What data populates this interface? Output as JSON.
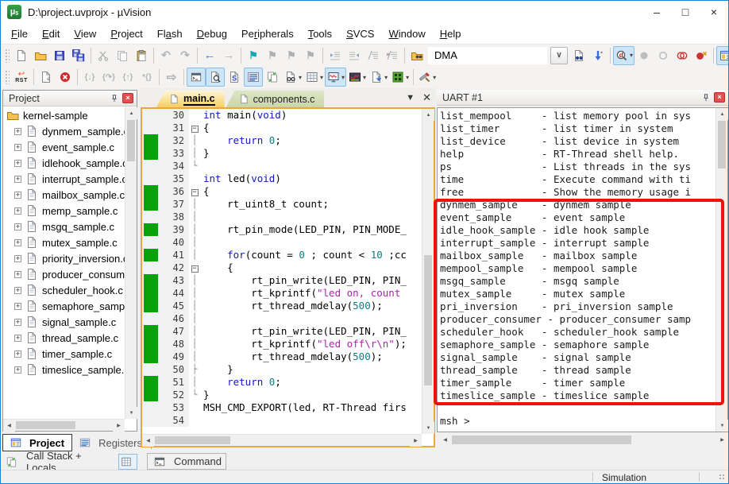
{
  "window": {
    "title": "D:\\project.uvprojx - µVision",
    "controls": {
      "minimize": "–",
      "maximize": "□",
      "close": "×"
    }
  },
  "menu": {
    "items": [
      {
        "label": "File",
        "u": 0
      },
      {
        "label": "Edit",
        "u": 0
      },
      {
        "label": "View",
        "u": 0
      },
      {
        "label": "Project",
        "u": 0
      },
      {
        "label": "Flash",
        "u": 2
      },
      {
        "label": "Debug",
        "u": 0
      },
      {
        "label": "Peripherals",
        "u": 2
      },
      {
        "label": "Tools",
        "u": 0
      },
      {
        "label": "SVCS",
        "u": 0
      },
      {
        "label": "Window",
        "u": 0
      },
      {
        "label": "Help",
        "u": 0
      }
    ]
  },
  "toolbar_main": {
    "search_value": "DMA",
    "items": [
      {
        "grip": true
      },
      {
        "n": "new-file",
        "k": "page"
      },
      {
        "n": "open-file",
        "k": "folder"
      },
      {
        "n": "save",
        "k": "floppy"
      },
      {
        "n": "save-all",
        "k": "floppy2"
      },
      {
        "sep": true
      },
      {
        "n": "cut",
        "k": "scissors"
      },
      {
        "n": "copy",
        "k": "copy"
      },
      {
        "n": "paste",
        "k": "paste"
      },
      {
        "sep": true
      },
      {
        "n": "undo",
        "k": "undo"
      },
      {
        "n": "redo",
        "k": "redo"
      },
      {
        "sep": true
      },
      {
        "n": "navigate-back",
        "k": "arrowL"
      },
      {
        "n": "navigate-forward",
        "k": "arrowR"
      },
      {
        "sep": true
      },
      {
        "n": "bookmark-toggle",
        "k": "flag"
      },
      {
        "n": "bookmark-prev",
        "k": "flagP"
      },
      {
        "n": "bookmark-next",
        "k": "flagN"
      },
      {
        "n": "bookmark-clear",
        "k": "flagX"
      },
      {
        "sep": true
      },
      {
        "n": "indent",
        "k": "indentR"
      },
      {
        "n": "unindent",
        "k": "indentL"
      },
      {
        "n": "comment",
        "k": "comment"
      },
      {
        "n": "uncomment",
        "k": "uncomment"
      },
      {
        "sep": true
      },
      {
        "n": "find-in-files",
        "k": "folderfind"
      },
      {
        "combo": true
      },
      {
        "n": "search-dropdown",
        "k": "vee"
      },
      {
        "n": "find-in-files-doc",
        "k": "docfind"
      },
      {
        "n": "incremental-find",
        "k": "incsearch"
      },
      {
        "sep": true
      },
      {
        "n": "highlight-word",
        "k": "magd",
        "hl": true,
        "dd": true
      },
      {
        "n": "breakpoint-insert",
        "k": "dotGray"
      },
      {
        "n": "breakpoint-enable",
        "k": "circGray"
      },
      {
        "n": "breakpoint-disable-all",
        "k": "circRed"
      },
      {
        "n": "breakpoint-kill-all",
        "k": "circRedX"
      },
      {
        "sep": true
      },
      {
        "n": "configuration-window",
        "k": "winbook",
        "hl": true
      }
    ]
  },
  "toolbar_debug": {
    "items": [
      {
        "grip": true
      },
      {
        "n": "reset",
        "k": "rst"
      },
      {
        "sep": true
      },
      {
        "n": "show-next-statement",
        "k": "steplist"
      },
      {
        "n": "stop",
        "k": "stopx"
      },
      {
        "sep": true
      },
      {
        "n": "step-into",
        "k": "stepin"
      },
      {
        "n": "step-over",
        "k": "stepover"
      },
      {
        "n": "step-out",
        "k": "stepout"
      },
      {
        "n": "run-to-cursor",
        "k": "runto"
      },
      {
        "sep": true
      },
      {
        "n": "run",
        "k": "runarrow"
      },
      {
        "sep": true
      },
      {
        "n": "command-window",
        "k": "cmdwin",
        "hl": true
      },
      {
        "n": "disassembly-window",
        "k": "disasm",
        "hl": true
      },
      {
        "n": "symbol-window",
        "k": "symbol"
      },
      {
        "n": "registers-window",
        "k": "registers",
        "hl": true
      },
      {
        "n": "call-stack-window",
        "k": "callstack"
      },
      {
        "n": "watch-window",
        "k": "watch",
        "dd": true
      },
      {
        "n": "memory-window",
        "k": "memory",
        "dd": true
      },
      {
        "n": "serial-window",
        "k": "serial",
        "hl": true,
        "dd": true
      },
      {
        "n": "analysis-window",
        "k": "analysis",
        "dd": true
      },
      {
        "n": "trace-window",
        "k": "trace",
        "dd": true
      },
      {
        "n": "system-viewer",
        "k": "sysview",
        "dd": true
      },
      {
        "sep": true
      },
      {
        "n": "toolbox",
        "k": "toolbox",
        "dd": true
      }
    ]
  },
  "project_panel": {
    "title": "Project",
    "root": "kernel-sample",
    "files": [
      "dynmem_sample.c",
      "event_sample.c",
      "idlehook_sample.c",
      "interrupt_sample.c",
      "mailbox_sample.c",
      "memp_sample.c",
      "msgq_sample.c",
      "mutex_sample.c",
      "priority_inversion.c",
      "producer_consumer",
      "scheduler_hook.c",
      "semaphore_sample.",
      "signal_sample.c",
      "thread_sample.c",
      "timer_sample.c",
      "timeslice_sample.c"
    ]
  },
  "editor": {
    "tabs": [
      {
        "label": "main.c",
        "active": true
      },
      {
        "label": "components.c",
        "active": false
      }
    ],
    "code": {
      "lines": [
        {
          "n": 30,
          "f": "",
          "g": false,
          "s": [
            [
              "k",
              "int"
            ],
            [
              "p",
              " main("
            ],
            [
              "k",
              "void"
            ],
            [
              "p",
              ")"
            ]
          ]
        },
        {
          "n": 31,
          "f": "b",
          "g": false,
          "s": [
            [
              "p",
              "{"
            ]
          ]
        },
        {
          "n": 32,
          "f": "v",
          "g": true,
          "s": [
            [
              "p",
              "    "
            ],
            [
              "k",
              "return"
            ],
            [
              "p",
              " "
            ],
            [
              "n",
              "0"
            ],
            [
              "p",
              ";"
            ]
          ]
        },
        {
          "n": 33,
          "f": "v",
          "g": true,
          "s": [
            [
              "p",
              "}"
            ]
          ]
        },
        {
          "n": 34,
          "f": "e",
          "g": false,
          "s": []
        },
        {
          "n": 35,
          "f": "",
          "g": false,
          "s": [
            [
              "k",
              "int"
            ],
            [
              "p",
              " led("
            ],
            [
              "k",
              "void"
            ],
            [
              "p",
              ")"
            ]
          ]
        },
        {
          "n": 36,
          "f": "b",
          "g": true,
          "s": [
            [
              "p",
              "{"
            ]
          ]
        },
        {
          "n": 37,
          "f": "v",
          "g": true,
          "s": [
            [
              "p",
              "    rt_uint8_t count;"
            ]
          ]
        },
        {
          "n": 38,
          "f": "v",
          "g": false,
          "s": []
        },
        {
          "n": 39,
          "f": "v",
          "g": true,
          "s": [
            [
              "p",
              "    rt_pin_mode(LED_PIN, PIN_MODE_"
            ]
          ]
        },
        {
          "n": 40,
          "f": "v",
          "g": false,
          "s": []
        },
        {
          "n": 41,
          "f": "v",
          "g": true,
          "s": [
            [
              "p",
              "    "
            ],
            [
              "k",
              "for"
            ],
            [
              "p",
              "(count = "
            ],
            [
              "n",
              "0"
            ],
            [
              "p",
              " ; count < "
            ],
            [
              "n",
              "10"
            ],
            [
              "p",
              " ;cc"
            ]
          ]
        },
        {
          "n": 42,
          "f": "b",
          "g": false,
          "s": [
            [
              "p",
              "    {"
            ]
          ]
        },
        {
          "n": 43,
          "f": "v",
          "g": true,
          "s": [
            [
              "p",
              "        rt_pin_write(LED_PIN, PIN_"
            ]
          ]
        },
        {
          "n": 44,
          "f": "v",
          "g": true,
          "s": [
            [
              "p",
              "        rt_kprintf("
            ],
            [
              "s",
              "\"led on, count"
            ]
          ]
        },
        {
          "n": 45,
          "f": "v",
          "g": true,
          "s": [
            [
              "p",
              "        rt_thread_mdelay("
            ],
            [
              "n",
              "500"
            ],
            [
              "p",
              ");"
            ]
          ]
        },
        {
          "n": 46,
          "f": "v",
          "g": false,
          "s": []
        },
        {
          "n": 47,
          "f": "v",
          "g": true,
          "s": [
            [
              "p",
              "        rt_pin_write(LED_PIN, PIN_"
            ]
          ]
        },
        {
          "n": 48,
          "f": "v",
          "g": true,
          "s": [
            [
              "p",
              "        rt_kprintf("
            ],
            [
              "s",
              "\"led off\\r\\n\""
            ],
            [
              "p",
              ");"
            ]
          ]
        },
        {
          "n": 49,
          "f": "v",
          "g": true,
          "s": [
            [
              "p",
              "        rt_thread_mdelay("
            ],
            [
              "n",
              "500"
            ],
            [
              "p",
              ");"
            ]
          ]
        },
        {
          "n": 50,
          "f": "t",
          "g": false,
          "s": [
            [
              "p",
              "    }"
            ]
          ]
        },
        {
          "n": 51,
          "f": "v",
          "g": true,
          "s": [
            [
              "p",
              "    "
            ],
            [
              "k",
              "return"
            ],
            [
              "p",
              " "
            ],
            [
              "n",
              "0"
            ],
            [
              "p",
              ";"
            ]
          ]
        },
        {
          "n": 52,
          "f": "e",
          "g": true,
          "s": [
            [
              "p",
              "}"
            ]
          ]
        },
        {
          "n": 53,
          "f": "",
          "g": false,
          "s": [
            [
              "p",
              "MSH_CMD_EXPORT(led, RT-Thread firs"
            ]
          ]
        },
        {
          "n": 54,
          "f": "",
          "g": false,
          "s": []
        }
      ]
    }
  },
  "uart_panel": {
    "title": "UART #1",
    "lines": [
      "list_mempool     - list memory pool in sys",
      "list_timer       - list timer in system",
      "list_device      - list device in system",
      "help             - RT-Thread shell help.",
      "ps               - List threads in the sys",
      "time             - Execute command with ti",
      "free             - Show the memory usage i",
      "dynmem_sample    - dynmem sample",
      "event_sample     - event sample",
      "idle_hook_sample - idle hook sample",
      "interrupt_sample - interrupt sample",
      "mailbox_sample   - mailbox sample",
      "mempool_sample   - mempool sample",
      "msgq_sample      - msgq sample",
      "mutex_sample     - mutex sample",
      "pri_inversion    - pri_inversion sample",
      "producer_consumer - producer_consumer samp",
      "scheduler_hook   - scheduler_hook sample",
      "semaphore_sample - semaphore sample",
      "signal_sample    - signal sample",
      "thread_sample    - thread sample",
      "timer_sample     - timer sample",
      "timeslice_sample - timeslice sample",
      "",
      "msh >"
    ]
  },
  "bottom": {
    "tabs": [
      {
        "label": "Project",
        "active": true
      },
      {
        "label": "Registers",
        "active": false
      }
    ],
    "callstack_label": "Call Stack + Locals",
    "command_tab": "Command"
  },
  "status_bar": {
    "mode": "Simulation"
  },
  "colors": {
    "keyword": "#1414c8",
    "number": "#0f8080",
    "string": "#b020b0",
    "green_change_bar": "#0aa00a",
    "highlight_rectangle": "#ee1306",
    "active_tab": "#f6ce62",
    "inactive_tab": "#c9d6a8"
  }
}
